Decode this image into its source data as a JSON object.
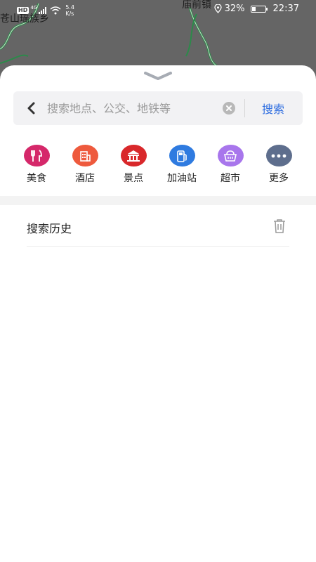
{
  "status_bar": {
    "network_badge": "HD",
    "network_type": "4G",
    "speed_value": "5.4",
    "speed_unit": "K/s",
    "battery": "32%",
    "battery_level": 0.32,
    "time": "22:37"
  },
  "map": {
    "label_left": "苍山瑶族乡",
    "label_right": "庙前镇"
  },
  "search": {
    "placeholder": "搜索地点、公交、地铁等",
    "value": "",
    "button_label": "搜索"
  },
  "categories": [
    {
      "label": "美食",
      "icon": "food-icon",
      "color": "#d5286a"
    },
    {
      "label": "酒店",
      "icon": "hotel-icon",
      "color": "#ee5a3d"
    },
    {
      "label": "景点",
      "icon": "attraction-icon",
      "color": "#d9282b"
    },
    {
      "label": "加油站",
      "icon": "gas-station-icon",
      "color": "#2f7be0"
    },
    {
      "label": "超市",
      "icon": "supermarket-icon",
      "color": "#a876ec"
    },
    {
      "label": "更多",
      "icon": "more-icon",
      "color": "#5e6e8d"
    }
  ],
  "history": {
    "title": "搜索历史"
  }
}
